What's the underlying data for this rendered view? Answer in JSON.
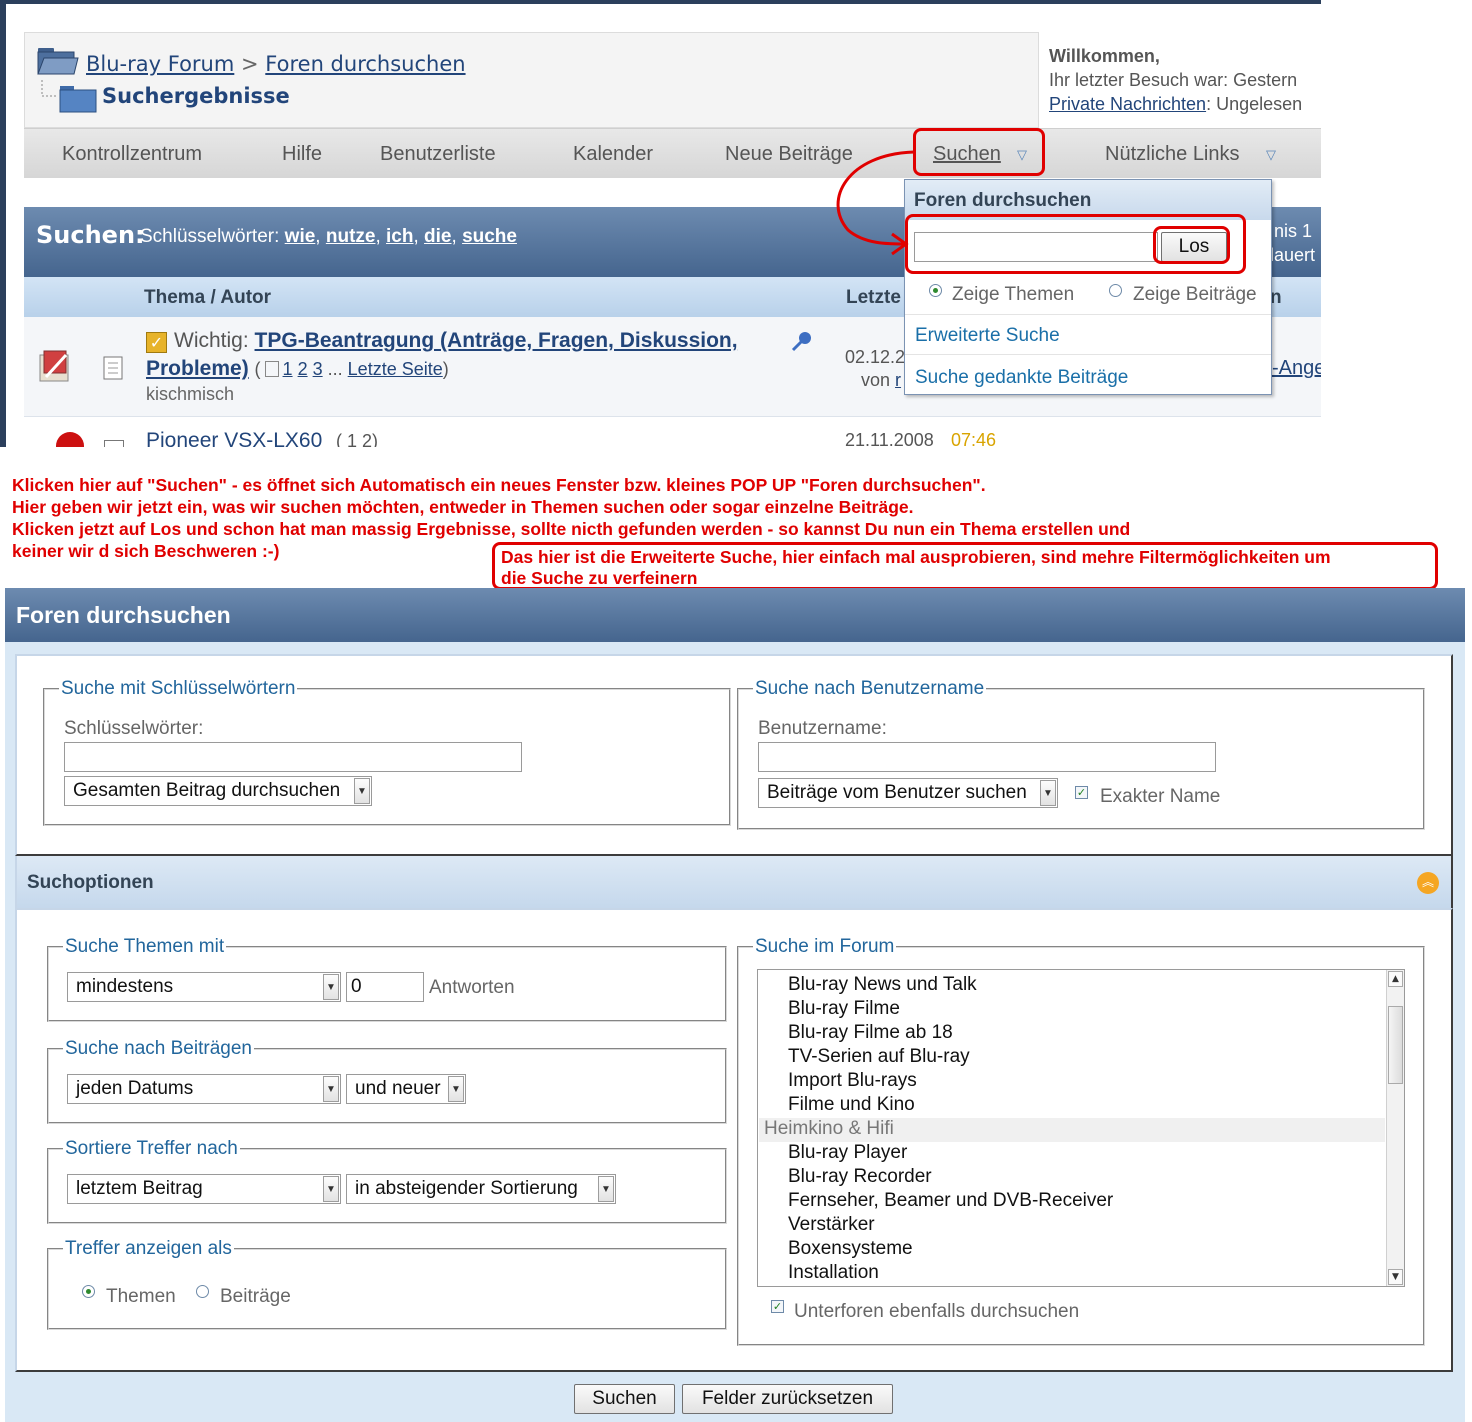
{
  "top_screenshot": {
    "breadcrumb": {
      "forum_link": "Blu-ray Forum",
      "separator": ">",
      "search_link": "Foren durchsuchen",
      "current": "Suchergebnisse"
    },
    "welcome": {
      "greeting": "Willkommen,",
      "last_visit": "Ihr letzter Besuch war: Gestern",
      "pm_link": "Private Nachrichten",
      "pm_status": ": Ungelesen"
    },
    "menu": [
      "Kontrollzentrum",
      "Hilfe",
      "Benutzerliste",
      "Kalender",
      "Neue Beiträge",
      "Suchen",
      "Nützliche Links"
    ],
    "search_header": {
      "label": "Suchen:",
      "keywords_label": "Schlüsselwörter:",
      "keywords": [
        "wie",
        "nutze",
        "ich",
        "die",
        "suche"
      ],
      "sep": ",",
      "right_line1": "nis 1",
      "right_line2": "lauert"
    },
    "columns": {
      "thread_author": "Thema / Autor",
      "last": "Letzte",
      "right": "n"
    },
    "row1": {
      "prefix": "Wichtig:",
      "title_line1": "TPG-Beantragung (Anträge, Fragen, Diskussion,",
      "title_line2": "Probleme)",
      "paren_open": "(",
      "pages": [
        "1",
        "2",
        "3"
      ],
      "ellipsis": "...",
      "last_page": "Letzte Seite",
      "paren_close": ")",
      "author": "kischmisch",
      "date": "02.12.2",
      "by": "von",
      "by_name": "r",
      "right_link": "-Ange"
    },
    "row2": {
      "title": "Pioneer VSX-LX60",
      "pages": "(  1 2)",
      "date": "21.11.2008",
      "time": "07:46"
    },
    "popup": {
      "title": "Foren durchsuchen",
      "go_button": "Los",
      "show_threads": "Zeige Themen",
      "show_posts": "Zeige Beiträge",
      "advanced": "Erweiterte Suche",
      "thanked": "Suche gedankte Beiträge"
    }
  },
  "annotations": {
    "line1": "Klicken hier auf \"Suchen\" - es öffnet sich Automatisch ein neues Fenster bzw. kleines POP UP \"Foren durchsuchen\".",
    "line2": "Hier geben wir jetzt ein, was wir suchen möchten, entweder in Themen suchen oder sogar einzelne Beiträge.",
    "line3": "Klicken jetzt auf Los und schon hat man massig Ergebnisse, sollte nicth gefunden werden - so kannst Du nun ein Thema erstellen und",
    "line4": "keiner wir d sich Beschweren :-)",
    "box_line1": "Das hier ist die Erweiterte Suche, hier einfach mal ausprobieren, sind mehre Filtermöglichkeiten um",
    "box_line2": "die Suche zu verfeinern",
    "color": "#e00000"
  },
  "search_form": {
    "title": "Foren durchsuchen",
    "keywords_fs": {
      "legend": "Suche mit Schlüsselwörtern",
      "label": "Schlüsselwörter:",
      "value": "",
      "scope": "Gesamten Beitrag durchsuchen"
    },
    "user_fs": {
      "legend": "Suche nach Benutzername",
      "label": "Benutzername:",
      "value": "",
      "mode": "Beiträge vom Benutzer suchen",
      "exact": "Exakter Name"
    },
    "options_title": "Suchoptionen",
    "threads_fs": {
      "legend": "Suche Themen mit",
      "mode": "mindestens",
      "count": "0",
      "suffix": "Antworten"
    },
    "posts_fs": {
      "legend": "Suche nach Beiträgen",
      "date": "jeden Datums",
      "direction": "und neuer"
    },
    "sort_fs": {
      "legend": "Sortiere Treffer nach",
      "field": "letztem Beitrag",
      "order": "in absteigender Sortierung"
    },
    "show_fs": {
      "legend": "Treffer anzeigen als",
      "threads": "Themen",
      "posts": "Beiträge"
    },
    "forum_fs": {
      "legend": "Suche im Forum",
      "items": [
        {
          "label": "Blu-ray News und Talk",
          "cat": false
        },
        {
          "label": "Blu-ray Filme",
          "cat": false
        },
        {
          "label": "Blu-ray Filme ab 18",
          "cat": false
        },
        {
          "label": "TV-Serien auf Blu-ray",
          "cat": false
        },
        {
          "label": "Import Blu-rays",
          "cat": false
        },
        {
          "label": "Filme und Kino",
          "cat": false
        },
        {
          "label": "Heimkino & Hifi",
          "cat": true
        },
        {
          "label": "Blu-ray Player",
          "cat": false
        },
        {
          "label": "Blu-ray Recorder",
          "cat": false
        },
        {
          "label": "Fernseher, Beamer und DVB-Receiver",
          "cat": false
        },
        {
          "label": "Verstärker",
          "cat": false
        },
        {
          "label": "Boxensysteme",
          "cat": false
        },
        {
          "label": "Installation",
          "cat": false
        }
      ],
      "subforums": "Unterforen ebenfalls durchsuchen"
    },
    "submit": "Suchen",
    "reset": "Felder zurücksetzen"
  }
}
